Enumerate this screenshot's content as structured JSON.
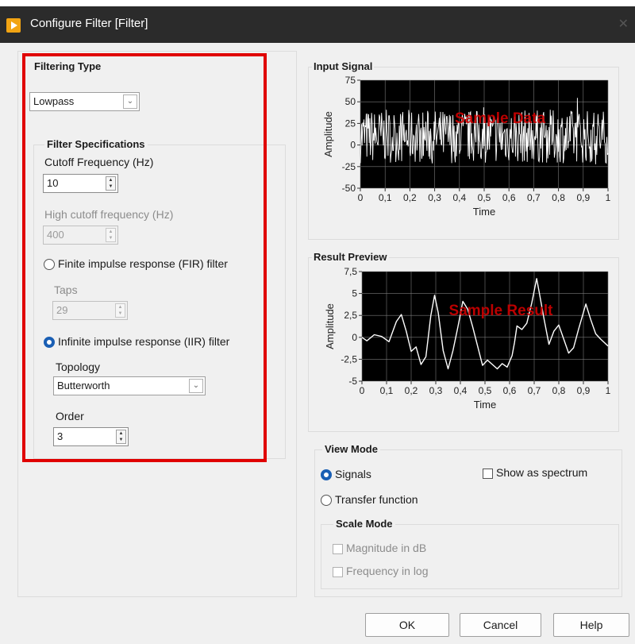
{
  "window": {
    "title": "Configure Filter [Filter]"
  },
  "filter_panel": {
    "filtering_type_label": "Filtering Type",
    "filtering_type_value": "Lowpass",
    "specs_label": "Filter Specifications",
    "cutoff_label": "Cutoff Frequency (Hz)",
    "cutoff_value": "10",
    "high_cutoff_label": "High cutoff frequency (Hz)",
    "high_cutoff_value": "400",
    "fir_label": "Finite impulse response (FIR) filter",
    "taps_label": "Taps",
    "taps_value": "29",
    "iir_label": "Infinite impulse response (IIR) filter",
    "topology_label": "Topology",
    "topology_value": "Butterworth",
    "order_label": "Order",
    "order_value": "3",
    "selected_filter": "iir"
  },
  "input_signal": {
    "title": "Input Signal",
    "watermark": "Sample Data",
    "ylabel": "Amplitude",
    "xlabel": "Time",
    "yticks": [
      "75",
      "50",
      "25",
      "0",
      "-25",
      "-50"
    ],
    "xticks": [
      "0",
      "0,1",
      "0,2",
      "0,3",
      "0,4",
      "0,5",
      "0,6",
      "0,7",
      "0,8",
      "0,9",
      "1"
    ]
  },
  "result_preview": {
    "title": "Result Preview",
    "watermark": "Sample Result",
    "ylabel": "Amplitude",
    "xlabel": "Time",
    "yticks": [
      "7,5",
      "5",
      "2,5",
      "0",
      "-2,5",
      "-5"
    ],
    "xticks": [
      "0",
      "0,1",
      "0,2",
      "0,3",
      "0,4",
      "0,5",
      "0,6",
      "0,7",
      "0,8",
      "0,9",
      "1"
    ]
  },
  "view_mode": {
    "label": "View Mode",
    "signals_label": "Signals",
    "transfer_label": "Transfer function",
    "spectrum_label": "Show as spectrum",
    "scale_label": "Scale Mode",
    "magnitude_label": "Magnitude in dB",
    "frequency_label": "Frequency in log",
    "selected": "signals"
  },
  "buttons": {
    "ok": "OK",
    "cancel": "Cancel",
    "help": "Help"
  },
  "colors": {
    "plot_bg": "#000000",
    "trace": "#ffffff",
    "watermark": "#d00000",
    "highlight": "#e00000",
    "radio_on": "#1a5fb4"
  }
}
